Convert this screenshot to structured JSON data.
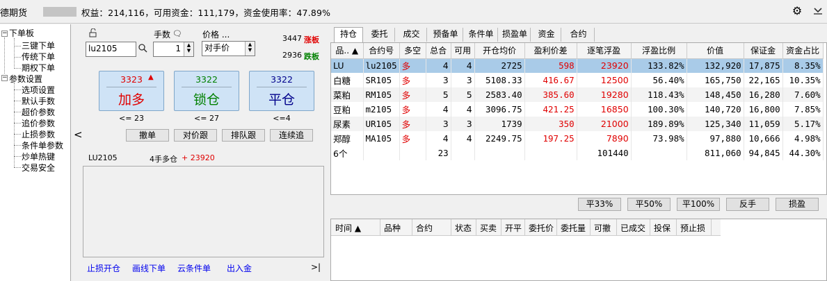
{
  "header": {
    "app_title": "德期货",
    "equity_text": "权益：214,116，可用资金：111,179，资金使用率：47.89%",
    "icons": [
      "gear-icon",
      "chevron-down-icon"
    ]
  },
  "tree": {
    "groups": [
      {
        "label": "下单板",
        "children": [
          "三键下单",
          "传统下单",
          "期权下单"
        ]
      },
      {
        "label": "参数设置",
        "children": [
          "选项设置",
          "默认手数",
          "超价参数",
          "追价参数",
          "止损参数",
          "条件单参数",
          "炒单热键",
          "交易安全"
        ]
      }
    ]
  },
  "order_panel": {
    "lots_label": "手数",
    "price_label": "价格 ...",
    "contract": "lu2105",
    "lots": "1",
    "price_type": "对手价",
    "limit_up_price": "3447",
    "limit_up_label": "涨板",
    "limit_down_price": "2936",
    "limit_down_label": "跌板",
    "buttons": [
      {
        "price": "3323",
        "label": "加多",
        "limit": "<= 23"
      },
      {
        "price": "3322",
        "label": "锁仓",
        "limit": "<= 27"
      },
      {
        "price": "3322",
        "label": "平仓",
        "limit": "<=4"
      }
    ],
    "small_buttons": [
      "撤单",
      "对价跟",
      "排队跟",
      "连续追"
    ],
    "position_contract": "LU2105",
    "position_text": "4手多仓",
    "position_pnl": "+ 23920",
    "bottom_links": [
      "止损开仓",
      "画线下单",
      "云条件单",
      "出入金"
    ],
    "collapse_glyph": "<",
    "end_glyph": ">|"
  },
  "tabs": [
    "持仓",
    "委托",
    "成交",
    "预备单",
    "条件单",
    "损盈单",
    "资金",
    "合约"
  ],
  "positions": {
    "columns": [
      "品.. ▲",
      "合约号",
      "多空",
      "总合",
      "可用",
      "开仓均价",
      "盈利价差",
      "逐笔浮盈",
      "浮盈比例",
      "价值",
      "保证金",
      "资金占比"
    ],
    "rows": [
      [
        "LU",
        "lu2105",
        "多",
        "4",
        "4",
        "2725",
        "598",
        "23920",
        "133.82%",
        "132,920",
        "17,875",
        "8.35%"
      ],
      [
        "白糖",
        "SR105",
        "多",
        "3",
        "3",
        "5108.33",
        "416.67",
        "12500",
        "56.40%",
        "165,750",
        "22,165",
        "10.35%"
      ],
      [
        "菜粕",
        "RM105",
        "多",
        "5",
        "5",
        "2583.40",
        "385.60",
        "19280",
        "118.43%",
        "148,450",
        "16,280",
        "7.60%"
      ],
      [
        "豆粕",
        "m2105",
        "多",
        "4",
        "4",
        "3096.75",
        "421.25",
        "16850",
        "100.30%",
        "140,720",
        "16,800",
        "7.85%"
      ],
      [
        "尿素",
        "UR105",
        "多",
        "3",
        "3",
        "1739",
        "350",
        "21000",
        "189.89%",
        "125,340",
        "11,059",
        "5.17%"
      ],
      [
        "郑醇",
        "MA105",
        "多",
        "4",
        "4",
        "2249.75",
        "197.25",
        "7890",
        "73.98%",
        "97,880",
        "10,666",
        "4.98%"
      ]
    ],
    "total": [
      "6个",
      "",
      "",
      "23",
      "",
      "",
      "",
      "101440",
      "",
      "811,060",
      "94,845",
      "44.30%"
    ]
  },
  "action_buttons": [
    "平33%",
    "平50%",
    "平100%",
    "反手",
    "损盈"
  ],
  "orders": {
    "columns": [
      "时间 ▲",
      "品种",
      "合约",
      "状态",
      "买卖",
      "开平",
      "委托价",
      "委托量",
      "可撤",
      "已成交",
      "投保",
      "预止损"
    ]
  }
}
